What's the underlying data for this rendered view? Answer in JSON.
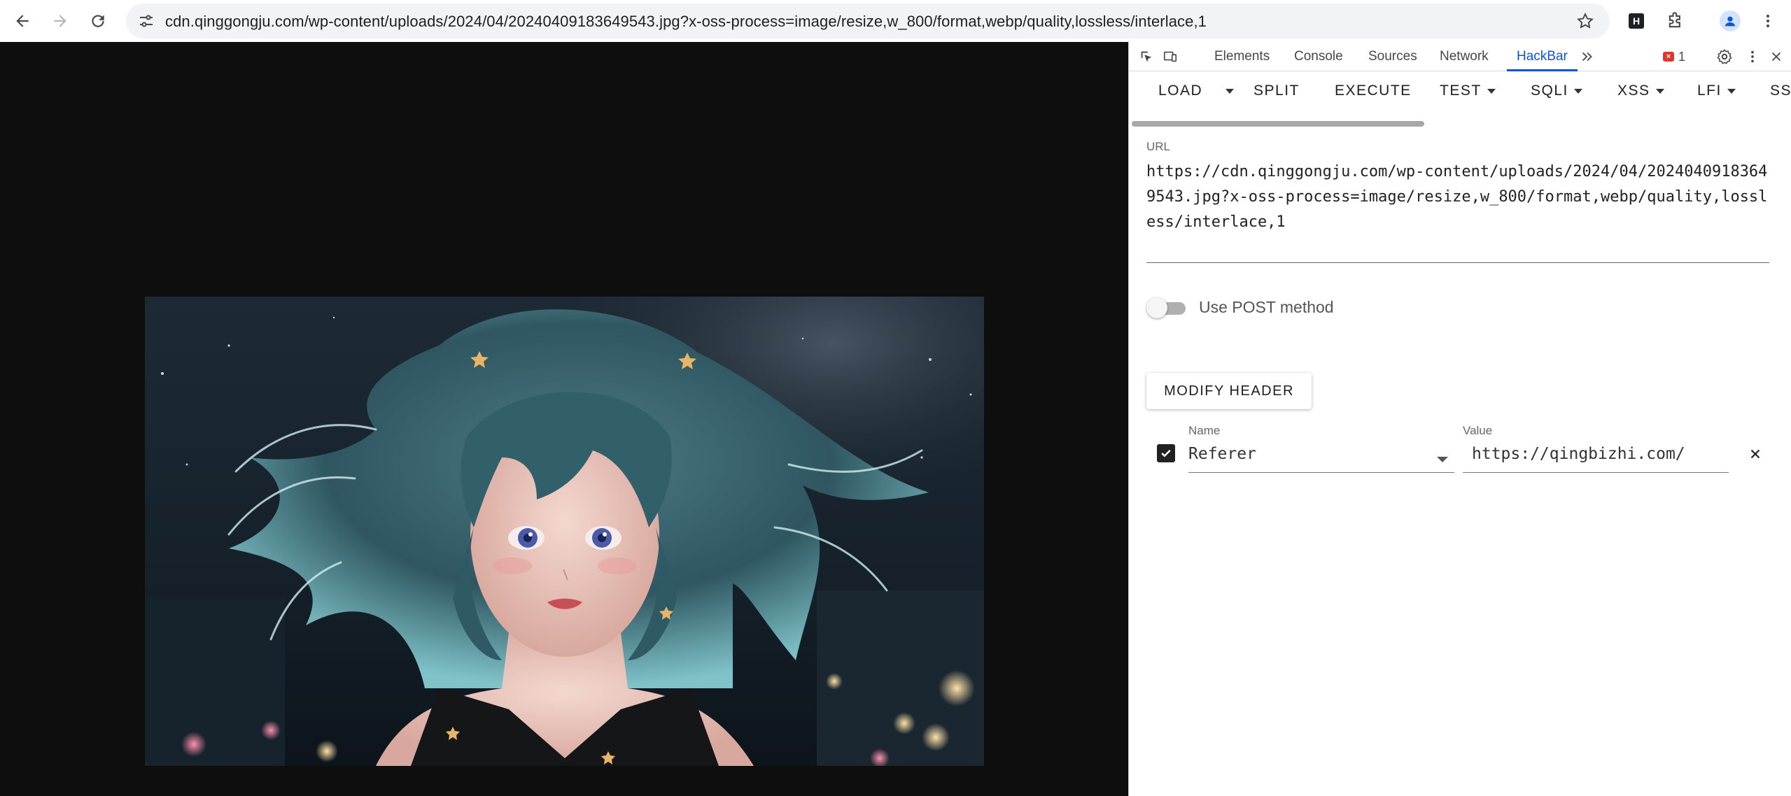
{
  "browser": {
    "url": "cdn.qinggongju.com/wp-content/uploads/2024/04/20240409183649543.jpg?x-oss-process=image/resize,w_800/format,webp/quality,lossless/interlace,1",
    "extension_badge": "H"
  },
  "devtools": {
    "tabs": [
      {
        "label": "Elements"
      },
      {
        "label": "Console"
      },
      {
        "label": "Sources"
      },
      {
        "label": "Network"
      },
      {
        "label": "HackBar"
      }
    ],
    "active_tab": "HackBar",
    "error_count": "1"
  },
  "hackbar": {
    "toolbar": {
      "load": "LOAD",
      "split": "SPLIT",
      "execute": "EXECUTE",
      "test": "TEST",
      "sqli": "SQLI",
      "xss": "XSS",
      "lfi": "LFI",
      "ssti": "SS"
    },
    "url_label": "URL",
    "url_value": "https://cdn.qinggongju.com/wp-content/uploads/2024/04/20240409183649543.jpg?x-oss-process=image/resize,w_800/format,webp/quality,lossless/interlace,1",
    "post_label": "Use POST method",
    "post_enabled": false,
    "modify_header_label": "MODIFY HEADER",
    "header": {
      "enabled": true,
      "name_label": "Name",
      "name_value": "Referer",
      "value_label": "Value",
      "value_value": "https://qingbizhi.com/"
    }
  },
  "colors": {
    "page_background": "#0e0e0e",
    "devtools_accent": "#0b57d0",
    "error": "#dc362e"
  }
}
